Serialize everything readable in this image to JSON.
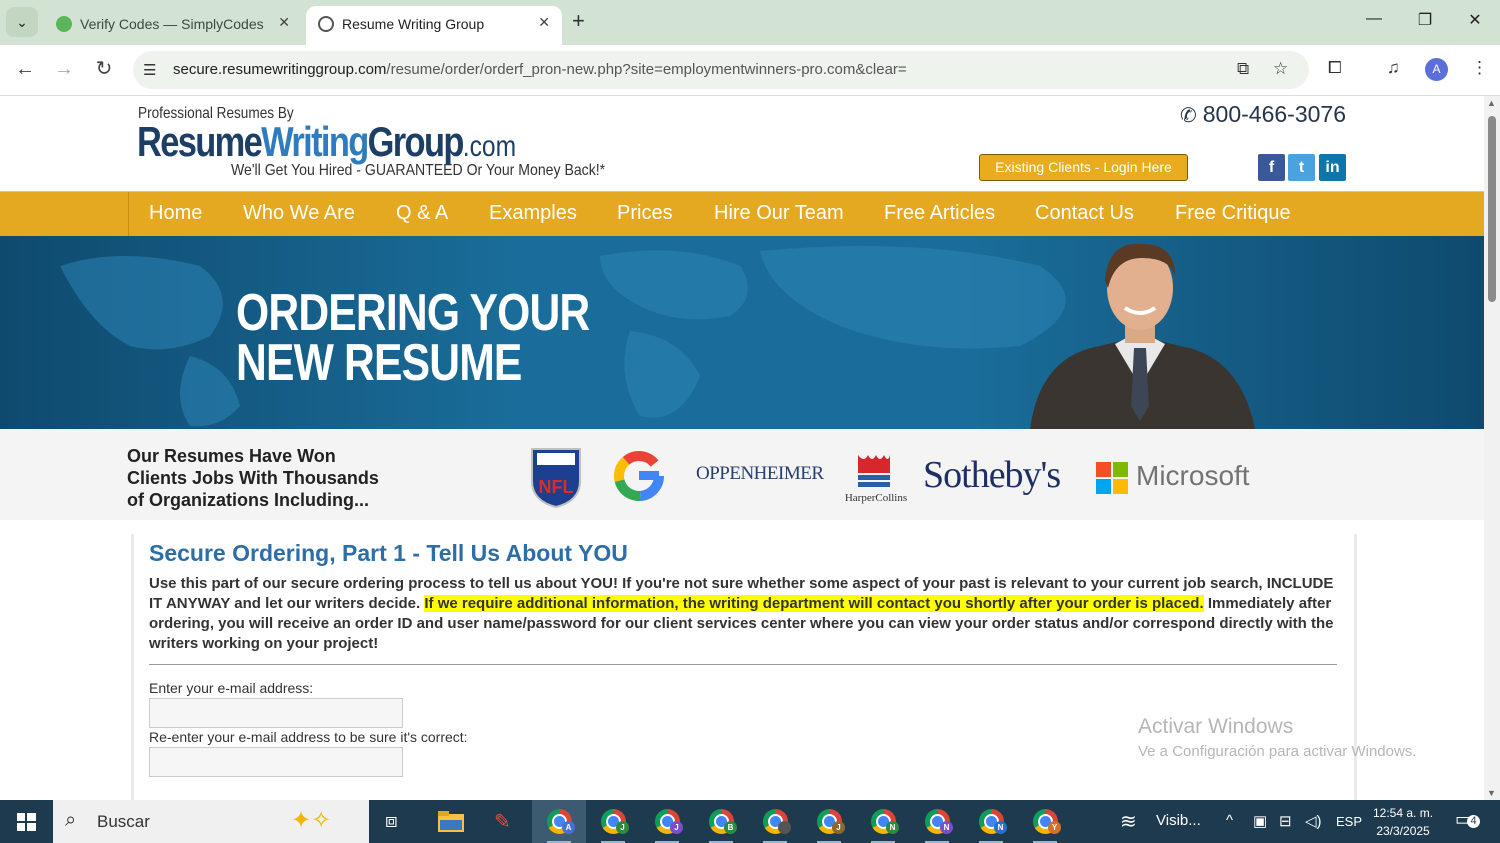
{
  "browser": {
    "tabs": [
      {
        "title": "Verify Codes — SimplyCodes",
        "active": false
      },
      {
        "title": "Resume Writing Group",
        "active": true
      }
    ],
    "url_domain": "secure.resumewritinggroup.com",
    "url_path": "/resume/order/orderf_pron-new.php?site=employmentwinners-pro.com&clear=",
    "profile_initial": "A"
  },
  "header": {
    "logo_prefix": "Professional Resumes By",
    "logo_part1": "Resume",
    "logo_part2": "Writing",
    "logo_part3": "Group",
    "logo_part4": ".com",
    "tagline": "We'll Get You Hired  - GUARANTEED Or Your Money Back!*",
    "phone": "800-466-3076",
    "login_label": "Existing Clients - Login Here",
    "social": {
      "facebook": "f",
      "twitter": "t",
      "linkedin": "in"
    }
  },
  "nav": [
    "Home",
    "Who We Are",
    "Q & A",
    "Examples",
    "Prices",
    "Hire Our Team",
    "Free Articles",
    "Contact Us",
    "Free Critique"
  ],
  "hero": {
    "line1": "ORDERING YOUR",
    "line2": "NEW RESUME"
  },
  "clients": {
    "text_line1": "Our Resumes Have Won",
    "text_line2": "Clients Jobs With Thousands",
    "text_line3": "of Organizations Including...",
    "logos": {
      "nfl": "NFL",
      "google": "G",
      "oppenheimer": "OPPENHEIMER",
      "harpercollins": "HarperCollins",
      "sothebys": "Sotheby's",
      "microsoft": "Microsoft"
    }
  },
  "main": {
    "title": "Secure Ordering, Part 1 - Tell Us About YOU",
    "intro_part1": "Use this part of our secure ordering process to tell us about YOU! If you're not sure whether some aspect of your past is relevant to your current job search, INCLUDE IT ANYWAY and let our writers decide. ",
    "intro_highlight": "If we require additional information, the writing department will contact you shortly after your order is placed.",
    "intro_part2": " Immediately after ordering, you will receive an order ID and user name/password for our client services center where you can view your order status and/or correspond directly with the writers working on your project!",
    "email_label": "Enter your e-mail address:",
    "email_value": "",
    "reenter_label": "Re-enter your e-mail address to be sure it's correct:",
    "reenter_value": ""
  },
  "watermark": {
    "line1": "Activar Windows",
    "line2": "Ve a Configuración para activar Windows."
  },
  "taskbar": {
    "search_placeholder": "Buscar",
    "weather": "Visib...",
    "language": "ESP",
    "time": "12:54 a. m.",
    "date": "23/3/2025",
    "notifications": "4",
    "chrome_badges": [
      {
        "letter": "A",
        "color": "#4a6fd6"
      },
      {
        "letter": "J",
        "color": "#2e8b3e"
      },
      {
        "letter": "J",
        "color": "#7a4fc9"
      },
      {
        "letter": "B",
        "color": "#2e8b3e"
      },
      {
        "letter": "",
        "color": "#555555"
      },
      {
        "letter": "J",
        "color": "#8a6a2e"
      },
      {
        "letter": "N",
        "color": "#2e8b3e"
      },
      {
        "letter": "N",
        "color": "#7a4fc9"
      },
      {
        "letter": "N",
        "color": "#2a6fc9"
      },
      {
        "letter": "Y",
        "color": "#d4702a"
      }
    ]
  },
  "colors": {
    "nav_bg": "#e5a821",
    "title_blue": "#2d6ea6",
    "highlight": "#ffff00",
    "login_bg": "#e8ac1e"
  }
}
